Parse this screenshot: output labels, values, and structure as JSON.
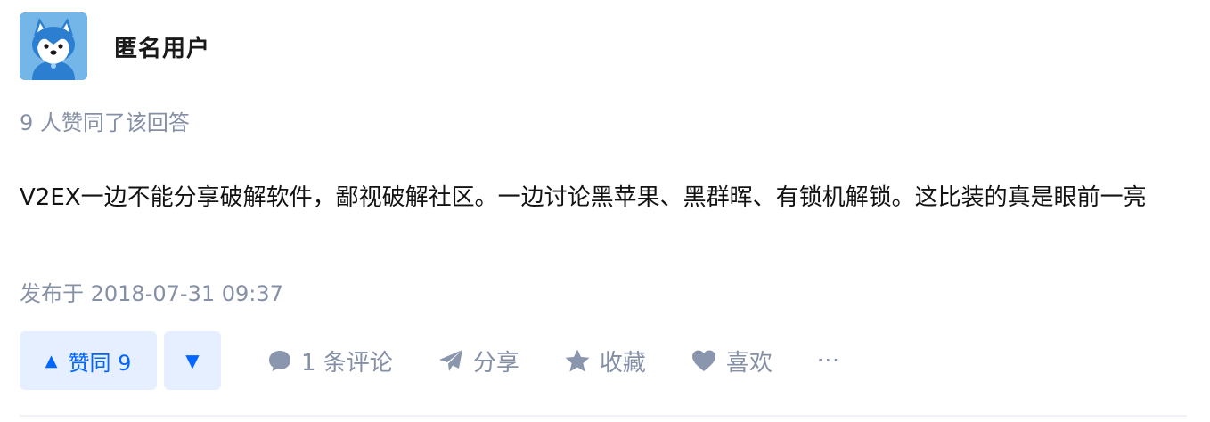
{
  "author": {
    "name": "匿名用户",
    "avatar_icon": "husky-avatar-icon"
  },
  "voters_text": "9 人赞同了该回答",
  "content": {
    "text": "V2EX一边不能分享破解软件，鄙视破解社区。一边讨论黑苹果、黑群晖、有锁机解锁。这比装的真是眼前一亮"
  },
  "timestamp": "发布于 2018-07-31 09:37",
  "actions": {
    "vote_up_arrow": "▲",
    "vote_up_label": "赞同 9",
    "vote_down_arrow": "▼",
    "comment_label": "1 条评论",
    "share_label": "分享",
    "favorite_label": "收藏",
    "like_label": "喜欢",
    "more_label": "···"
  },
  "colors": {
    "accent": "#0066ff",
    "vote_bg": "#e5efff",
    "muted": "#8590a6",
    "avatar_bg": "#6fb2e6"
  }
}
